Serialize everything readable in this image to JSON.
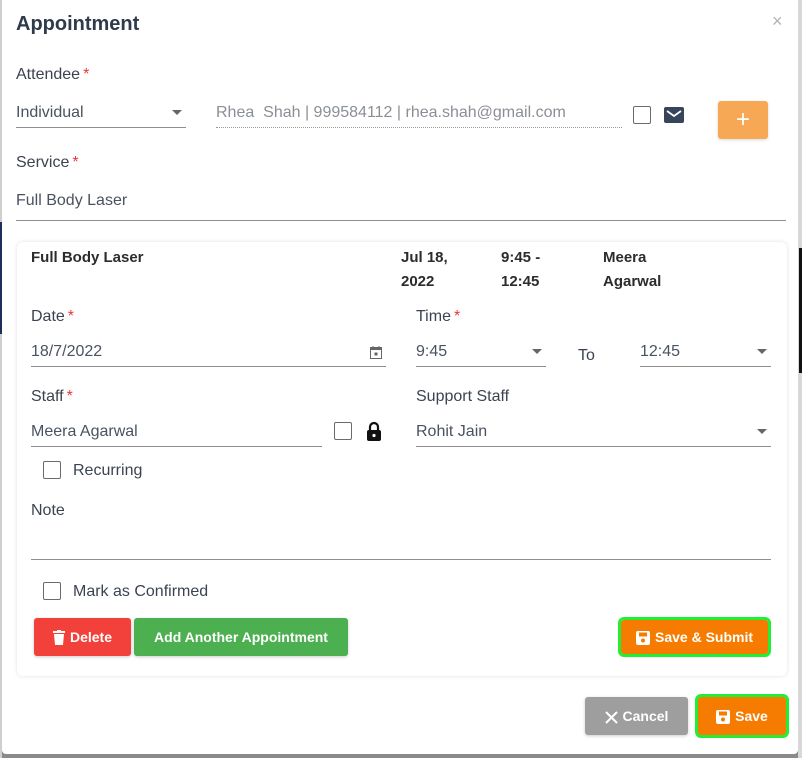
{
  "dialog": {
    "title": "Appointment",
    "close_icon": "×"
  },
  "attendee": {
    "label": "Attendee",
    "required_mark": "*",
    "type_value": "Individual",
    "client_value": "Rhea  Shah | 999584112 | rhea.shah@gmail.com",
    "add_button_label": "+"
  },
  "service": {
    "label": "Service",
    "required_mark": "*",
    "value": "Full Body Laser"
  },
  "summary": {
    "service": "Full Body Laser",
    "date_line1": "Jul 18,",
    "date_line2": "2022",
    "time_line1": "9:45 -",
    "time_line2": "12:45",
    "staff_line1": "Meera",
    "staff_line2": "Agarwal"
  },
  "form": {
    "date_label": "Date",
    "date_value": "18/7/2022",
    "time_label": "Time",
    "time_start": "9:45",
    "time_to": "To",
    "time_end": "12:45",
    "staff_label": "Staff",
    "staff_value": "Meera Agarwal",
    "support_staff_label": "Support Staff",
    "support_staff_value": "Rohit Jain",
    "recurring_label": "Recurring",
    "note_label": "Note",
    "note_value": "",
    "confirmed_label": "Mark as Confirmed",
    "required_mark": "*"
  },
  "buttons": {
    "delete": "Delete",
    "add_another": "Add Another Appointment",
    "save_submit": "Save & Submit",
    "cancel": "Cancel",
    "save": "Save"
  },
  "colors": {
    "accent_orange": "#f57c00",
    "plus_orange": "#f6a854",
    "delete_red": "#f2413a",
    "add_green": "#4caf50",
    "highlight_green": "#22ee33",
    "cancel_grey": "#9e9e9e"
  }
}
